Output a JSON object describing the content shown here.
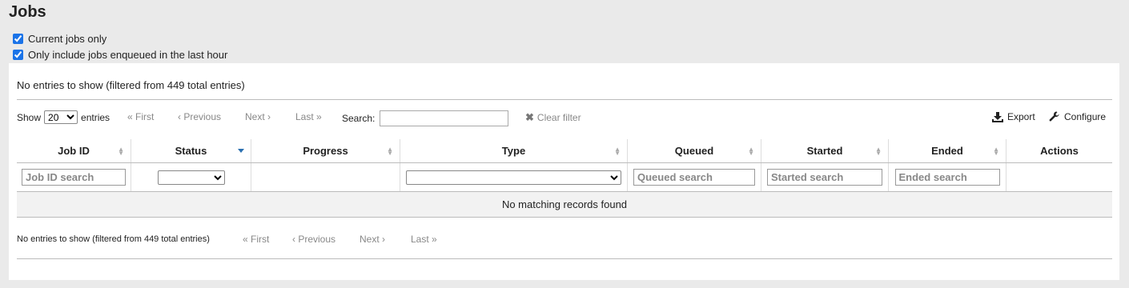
{
  "page": {
    "title": "Jobs"
  },
  "filters": {
    "current_only": {
      "label": "Current jobs only",
      "checked": true
    },
    "last_hour": {
      "label": "Only include jobs enqueued in the last hour",
      "checked": true
    }
  },
  "table_top": {
    "info": "No entries to show (filtered from 449 total entries)",
    "show_label": "Show",
    "entries_label": "entries",
    "page_size": "20",
    "pager": {
      "first": "« First",
      "previous": "‹ Previous",
      "next": "Next ›",
      "last": "Last »"
    },
    "search_label": "Search:",
    "search_value": "",
    "clear_filter": "Clear filter",
    "export": "Export",
    "configure": "Configure"
  },
  "columns": [
    "Job ID",
    "Status",
    "Progress",
    "Type",
    "Queued",
    "Started",
    "Ended",
    "Actions"
  ],
  "column_filters": {
    "job_id": "Job ID search",
    "queued": "Queued search",
    "started": "Started search",
    "ended": "Ended search"
  },
  "empty_message": "No matching records found",
  "table_bottom": {
    "info": "No entries to show (filtered from 449 total entries)",
    "pager": {
      "first": "« First",
      "previous": "‹ Previous",
      "next": "Next ›",
      "last": "Last »"
    }
  },
  "colors": {
    "accent": "#2a6fb0",
    "panel": "#ffffff",
    "background": "#eaeaea"
  }
}
